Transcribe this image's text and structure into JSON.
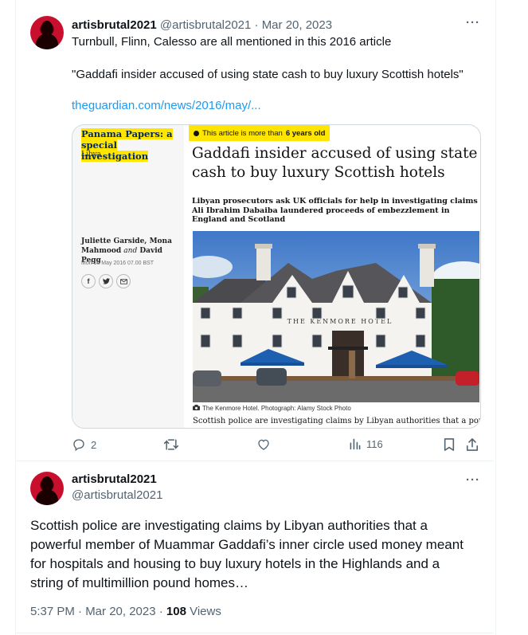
{
  "tweet1": {
    "display_name": "artisbrutal2021",
    "handle": "@artisbrutal2021",
    "date": "Mar 20, 2023",
    "handle_date": "@artisbrutal2021 · Mar 20, 2023",
    "text_line1": "Turnbull, Flinn, Calesso are all mentioned in this 2016 article",
    "text_line2": "\"Gaddafi insider accused of using state cash to buy luxury Scottish hotels\"",
    "link": "theguardian.com/news/2016/may/...",
    "replies": "2",
    "views": "116"
  },
  "card": {
    "series_title": "Panama Papers: a special investigation",
    "series_line1": "Panama Papers: a",
    "series_line2": "special investigation",
    "section": "Libya",
    "age_prefix": "This article is more than",
    "age_value": "6 years old",
    "headline_line1": "Gaddafi insider accused of using state",
    "headline_line2": "cash to buy luxury Scottish hotels",
    "standfirst_line1": "Libyan prosecutors ask UK officials for help in investigating claims",
    "standfirst_line2": "Ali Ibrahim Dabaiba laundered proceeds of embezzlement in",
    "standfirst_line3": "England and Scotland",
    "byline_line1": "Juliette Garside, Mona",
    "byline_line2a": "Mahmood ",
    "byline_and": "and",
    "byline_line2b": " David Pegg",
    "dateline": "Mon 16 May 2016 07.00 BST",
    "hotel_sign": "THE KENMORE HOTEL",
    "caption": "The Kenmore Hotel. Photograph: Alamy Stock Photo",
    "body_start": "Scottish police are investigating claims by Libyan authorities that a powerful"
  },
  "tweet2": {
    "display_name": "artisbrutal2021",
    "handle": "@artisbrutal2021",
    "text_line1": "Scottish police are investigating claims by Libyan authorities that a",
    "text_line2": "powerful member of Muammar Gaddafi’s inner circle used money meant",
    "text_line3": "for hospitals and housing to buy luxury hotels in the Highlands and a",
    "text_line4": "string of multimillion pound homes…",
    "time": "5:37 PM · Mar 20, 2023 · ",
    "views_count": "108",
    "views_label": " Views"
  },
  "colors": {
    "link": "#1d9bf0",
    "muted": "#536471",
    "highlight": "#ffe500",
    "avatar": "#c8102e"
  },
  "icons": [
    "reply-icon",
    "retweet-icon",
    "like-icon",
    "analytics-icon",
    "bookmark-icon",
    "share-icon",
    "more-icon",
    "camera-icon",
    "facebook-icon",
    "twitter-icon",
    "email-icon"
  ]
}
